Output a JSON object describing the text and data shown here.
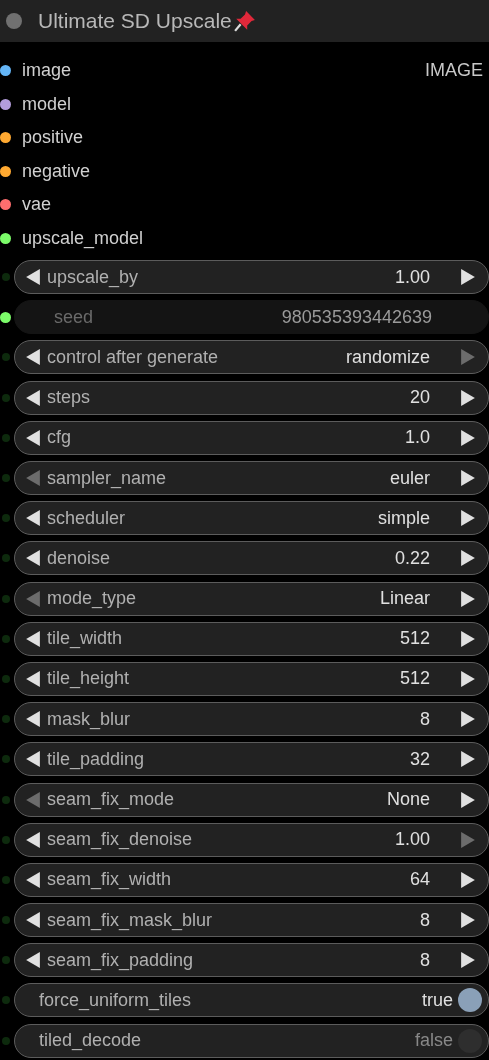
{
  "node": {
    "title": "Ultimate SD Upscale",
    "pinned": true
  },
  "inputs": [
    {
      "name": "image",
      "color": "#64b5f6"
    },
    {
      "name": "model",
      "color": "#b39ddb"
    },
    {
      "name": "positive",
      "color": "#ffa931"
    },
    {
      "name": "negative",
      "color": "#ffa931"
    },
    {
      "name": "vae",
      "color": "#ff6e6e"
    },
    {
      "name": "upscale_model",
      "color": "#7cfc6a"
    }
  ],
  "outputs": [
    {
      "name": "IMAGE"
    }
  ],
  "widgets": [
    {
      "kind": "number",
      "label": "upscale_by",
      "value": "1.00",
      "left_disabled": false,
      "right_disabled": false
    },
    {
      "kind": "input",
      "label": "seed",
      "value": "980535393442639",
      "color": "#7cfc6a"
    },
    {
      "kind": "combo",
      "label": "control after generate",
      "value": "randomize",
      "left_disabled": false,
      "right_disabled": true
    },
    {
      "kind": "number",
      "label": "steps",
      "value": "20",
      "left_disabled": false,
      "right_disabled": false
    },
    {
      "kind": "number",
      "label": "cfg",
      "value": "1.0",
      "left_disabled": false,
      "right_disabled": false
    },
    {
      "kind": "combo",
      "label": "sampler_name",
      "value": "euler",
      "left_disabled": true,
      "right_disabled": false
    },
    {
      "kind": "combo",
      "label": "scheduler",
      "value": "simple",
      "left_disabled": false,
      "right_disabled": false
    },
    {
      "kind": "number",
      "label": "denoise",
      "value": "0.22",
      "left_disabled": false,
      "right_disabled": false
    },
    {
      "kind": "combo",
      "label": "mode_type",
      "value": "Linear",
      "left_disabled": true,
      "right_disabled": false
    },
    {
      "kind": "number",
      "label": "tile_width",
      "value": "512",
      "left_disabled": false,
      "right_disabled": false
    },
    {
      "kind": "number",
      "label": "tile_height",
      "value": "512",
      "left_disabled": false,
      "right_disabled": false
    },
    {
      "kind": "number",
      "label": "mask_blur",
      "value": "8",
      "left_disabled": false,
      "right_disabled": false
    },
    {
      "kind": "number",
      "label": "tile_padding",
      "value": "32",
      "left_disabled": false,
      "right_disabled": false
    },
    {
      "kind": "combo",
      "label": "seam_fix_mode",
      "value": "None",
      "left_disabled": true,
      "right_disabled": false
    },
    {
      "kind": "number",
      "label": "seam_fix_denoise",
      "value": "1.00",
      "left_disabled": false,
      "right_disabled": true
    },
    {
      "kind": "number",
      "label": "seam_fix_width",
      "value": "64",
      "left_disabled": false,
      "right_disabled": false
    },
    {
      "kind": "number",
      "label": "seam_fix_mask_blur",
      "value": "8",
      "left_disabled": false,
      "right_disabled": false
    },
    {
      "kind": "number",
      "label": "seam_fix_padding",
      "value": "8",
      "left_disabled": false,
      "right_disabled": false
    },
    {
      "kind": "toggle",
      "label": "force_uniform_tiles",
      "value": "true",
      "on": true
    },
    {
      "kind": "toggle",
      "label": "tiled_decode",
      "value": "false",
      "on": false
    }
  ]
}
